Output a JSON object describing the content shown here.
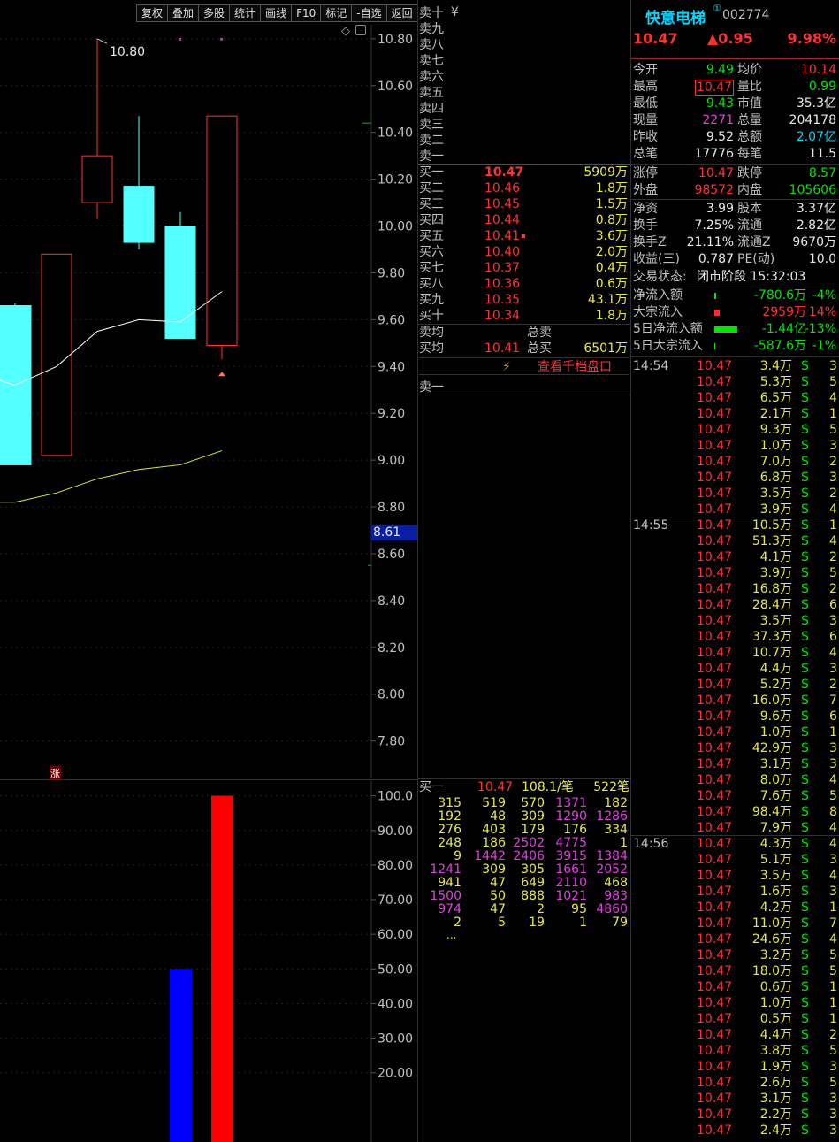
{
  "toolbar": {
    "buttons": [
      "复权",
      "叠加",
      "多股",
      "统计",
      "画线",
      "F10",
      "标记",
      "-自选",
      "返回"
    ]
  },
  "chart": {
    "price_axis": [
      "10.80",
      "10.60",
      "10.40",
      "10.20",
      "10.00",
      "9.80",
      "9.60",
      "9.40",
      "9.20",
      "9.00",
      "8.80",
      "8.60",
      "8.40",
      "8.20",
      "8.00",
      "7.80"
    ],
    "cursor_price": "8.61",
    "high_label": "10.80",
    "zhang_marker": "涨",
    "vol_axis": [
      "100.0",
      "90.00",
      "80.00",
      "70.00",
      "60.00",
      "50.00",
      "40.00",
      "30.00",
      "20.00"
    ],
    "colors": {
      "up": "#ff3232",
      "down": "#54ffff",
      "ma5": "#ffffff",
      "ma10": "#e8e84a",
      "vol_up": "#ff0000",
      "vol_down": "#0000ff"
    }
  },
  "orderbook": {
    "sell": [
      {
        "label": "卖十",
        "price": "",
        "vol": ""
      },
      {
        "label": "卖九",
        "price": "",
        "vol": ""
      },
      {
        "label": "卖八",
        "price": "",
        "vol": ""
      },
      {
        "label": "卖七",
        "price": "",
        "vol": ""
      },
      {
        "label": "卖六",
        "price": "",
        "vol": ""
      },
      {
        "label": "卖五",
        "price": "",
        "vol": ""
      },
      {
        "label": "卖四",
        "price": "",
        "vol": ""
      },
      {
        "label": "卖三",
        "price": "",
        "vol": ""
      },
      {
        "label": "卖二",
        "price": "",
        "vol": ""
      },
      {
        "label": "卖一",
        "price": "",
        "vol": ""
      }
    ],
    "yen_icon": "¥",
    "buy": [
      {
        "label": "买一",
        "price": "10.47",
        "vol": "5909万"
      },
      {
        "label": "买二",
        "price": "10.46",
        "vol": "1.8万"
      },
      {
        "label": "买三",
        "price": "10.45",
        "vol": "1.5万"
      },
      {
        "label": "买四",
        "price": "10.44",
        "vol": "0.8万"
      },
      {
        "label": "买五",
        "price": "10.41",
        "vol": "3.6万"
      },
      {
        "label": "买六",
        "price": "10.40",
        "vol": "2.0万"
      },
      {
        "label": "买七",
        "price": "10.37",
        "vol": "0.4万"
      },
      {
        "label": "买八",
        "price": "10.36",
        "vol": "0.6万"
      },
      {
        "label": "买九",
        "price": "10.35",
        "vol": "43.1万"
      },
      {
        "label": "买十",
        "price": "10.34",
        "vol": "1.8万"
      }
    ],
    "avg_sell_label": "卖均",
    "total_sell_label": "总卖",
    "avg_buy_label": "买均",
    "avg_buy_price": "10.41",
    "total_buy_label": "总买",
    "total_buy_vol": "6501万",
    "view_1000_label": "查看千档盘口",
    "sell1_label": "卖一"
  },
  "queue": {
    "label": "买一",
    "price": "10.47",
    "avg": "108.1/笔",
    "count": "522笔",
    "rows": [
      [
        {
          "v": "315",
          "c": "y"
        },
        {
          "v": "519",
          "c": "y"
        },
        {
          "v": "570",
          "c": "y"
        },
        {
          "v": "1371",
          "c": "m"
        },
        {
          "v": "182",
          "c": "y"
        }
      ],
      [
        {
          "v": "192",
          "c": "y"
        },
        {
          "v": "48",
          "c": "y"
        },
        {
          "v": "309",
          "c": "y"
        },
        {
          "v": "1290",
          "c": "m"
        },
        {
          "v": "1286",
          "c": "m"
        }
      ],
      [
        {
          "v": "276",
          "c": "y"
        },
        {
          "v": "403",
          "c": "y"
        },
        {
          "v": "179",
          "c": "y"
        },
        {
          "v": "176",
          "c": "y"
        },
        {
          "v": "334",
          "c": "y"
        }
      ],
      [
        {
          "v": "248",
          "c": "y"
        },
        {
          "v": "186",
          "c": "y"
        },
        {
          "v": "2502",
          "c": "m"
        },
        {
          "v": "4775",
          "c": "m"
        },
        {
          "v": "1",
          "c": "y"
        }
      ],
      [
        {
          "v": "9",
          "c": "y"
        },
        {
          "v": "1442",
          "c": "m"
        },
        {
          "v": "2406",
          "c": "m"
        },
        {
          "v": "3915",
          "c": "m"
        },
        {
          "v": "1384",
          "c": "m"
        }
      ],
      [
        {
          "v": "1241",
          "c": "m"
        },
        {
          "v": "309",
          "c": "y"
        },
        {
          "v": "305",
          "c": "y"
        },
        {
          "v": "1661",
          "c": "m"
        },
        {
          "v": "2052",
          "c": "m"
        }
      ],
      [
        {
          "v": "941",
          "c": "y"
        },
        {
          "v": "47",
          "c": "y"
        },
        {
          "v": "649",
          "c": "y"
        },
        {
          "v": "2110",
          "c": "m"
        },
        {
          "v": "468",
          "c": "y"
        }
      ],
      [
        {
          "v": "1500",
          "c": "m"
        },
        {
          "v": "50",
          "c": "y"
        },
        {
          "v": "888",
          "c": "y"
        },
        {
          "v": "1021",
          "c": "m"
        },
        {
          "v": "983",
          "c": "m"
        }
      ],
      [
        {
          "v": "974",
          "c": "m"
        },
        {
          "v": "47",
          "c": "y"
        },
        {
          "v": "2",
          "c": "y"
        },
        {
          "v": "95",
          "c": "y"
        },
        {
          "v": "4860",
          "c": "m"
        }
      ],
      [
        {
          "v": "2",
          "c": "y"
        },
        {
          "v": "5",
          "c": "y"
        },
        {
          "v": "19",
          "c": "y"
        },
        {
          "v": "1",
          "c": "y"
        },
        {
          "v": "79",
          "c": "y"
        }
      ]
    ],
    "more": "..."
  },
  "stock": {
    "name": "快意电梯",
    "superscript": "①",
    "code": "002774",
    "price": "10.47",
    "change": "▲0.95",
    "pct": "9.98%"
  },
  "quote": [
    {
      "l1": "今开",
      "v1": "9.49",
      "c1": "green",
      "l2": "均价",
      "v2": "10.14",
      "c2": "red"
    },
    {
      "l1": "最高",
      "v1": "10.47",
      "c1": "red",
      "l2": "量比",
      "v2": "0.99",
      "c2": "green",
      "box": true
    },
    {
      "l1": "最低",
      "v1": "9.43",
      "c1": "green",
      "l2": "市值",
      "v2": "35.3亿",
      "c2": "white"
    },
    {
      "l1": "现量",
      "v1": "2271",
      "c1": "magenta",
      "l2": "总量",
      "v2": "204178",
      "c2": "white"
    },
    {
      "l1": "昨收",
      "v1": "9.52",
      "c1": "white",
      "l2": "总额",
      "v2": "2.07亿",
      "c2": "cyan"
    },
    {
      "l1": "总笔",
      "v1": "17776",
      "c1": "white",
      "l2": "每笔",
      "v2": "11.5",
      "c2": "white"
    }
  ],
  "quote2": [
    {
      "l1": "涨停",
      "v1": "10.47",
      "c1": "red",
      "l2": "跌停",
      "v2": "8.57",
      "c2": "green"
    },
    {
      "l1": "外盘",
      "v1": "98572",
      "c1": "red",
      "l2": "内盘",
      "v2": "105606",
      "c2": "green"
    }
  ],
  "quote3": [
    {
      "l1": "净资",
      "v1": "3.99",
      "c1": "white",
      "l2": "股本",
      "v2": "3.37亿",
      "c2": "white"
    },
    {
      "l1": "换手",
      "v1": "7.25%",
      "c1": "white",
      "l2": "流通",
      "v2": "2.82亿",
      "c2": "white"
    },
    {
      "l1": "换手Z",
      "v1": "21.11%",
      "c1": "white",
      "l2": "流通Z",
      "v2": "9670万",
      "c2": "white"
    },
    {
      "l1": "收益(三)",
      "v1": "0.787",
      "c1": "white",
      "l2": "PE(动)",
      "v2": "10.0",
      "c2": "white"
    }
  ],
  "trade_status": {
    "label": "交易状态:",
    "value": "闭市阶段 15:32:03"
  },
  "flows": [
    {
      "label": "净流入额",
      "value": "-780.6万",
      "pct": "-4%",
      "color": "green",
      "bar": 2,
      "barcolor": "#00e600"
    },
    {
      "label": "大宗流入",
      "value": "2959万",
      "pct": "14%",
      "color": "red",
      "bar": 6,
      "barcolor": "#ff3232"
    },
    {
      "label": "5日净流入额",
      "value": "-1.44亿",
      "pct": "-13%",
      "color": "green",
      "bar": 26,
      "barcolor": "#00e600"
    },
    {
      "label": "5日大宗流入",
      "value": "-587.6万",
      "pct": "-1%",
      "color": "green",
      "bar": 1,
      "barcolor": "#00e600"
    }
  ],
  "ticks": [
    {
      "t": "14:54",
      "p": "10.47",
      "v": "3.4万",
      "s": "S",
      "n": "3"
    },
    {
      "t": "",
      "p": "10.47",
      "v": "5.3万",
      "s": "S",
      "n": "5"
    },
    {
      "t": "",
      "p": "10.47",
      "v": "6.5万",
      "s": "S",
      "n": "4"
    },
    {
      "t": "",
      "p": "10.47",
      "v": "2.1万",
      "s": "S",
      "n": "1"
    },
    {
      "t": "",
      "p": "10.47",
      "v": "9.3万",
      "s": "S",
      "n": "5"
    },
    {
      "t": "",
      "p": "10.47",
      "v": "1.0万",
      "s": "S",
      "n": "3"
    },
    {
      "t": "",
      "p": "10.47",
      "v": "7.0万",
      "s": "S",
      "n": "2"
    },
    {
      "t": "",
      "p": "10.47",
      "v": "6.8万",
      "s": "S",
      "n": "3"
    },
    {
      "t": "",
      "p": "10.47",
      "v": "3.5万",
      "s": "S",
      "n": "2"
    },
    {
      "t": "",
      "p": "10.47",
      "v": "3.9万",
      "s": "S",
      "n": "4"
    },
    {
      "t": "14:55",
      "p": "10.47",
      "v": "10.5万",
      "s": "S",
      "n": "1"
    },
    {
      "t": "",
      "p": "10.47",
      "v": "51.3万",
      "s": "S",
      "n": "4"
    },
    {
      "t": "",
      "p": "10.47",
      "v": "4.1万",
      "s": "S",
      "n": "2"
    },
    {
      "t": "",
      "p": "10.47",
      "v": "3.9万",
      "s": "S",
      "n": "5"
    },
    {
      "t": "",
      "p": "10.47",
      "v": "16.8万",
      "s": "S",
      "n": "2"
    },
    {
      "t": "",
      "p": "10.47",
      "v": "28.4万",
      "s": "S",
      "n": "6"
    },
    {
      "t": "",
      "p": "10.47",
      "v": "3.5万",
      "s": "S",
      "n": "3"
    },
    {
      "t": "",
      "p": "10.47",
      "v": "37.3万",
      "s": "S",
      "n": "6"
    },
    {
      "t": "",
      "p": "10.47",
      "v": "10.7万",
      "s": "S",
      "n": "4"
    },
    {
      "t": "",
      "p": "10.47",
      "v": "4.4万",
      "s": "S",
      "n": "3"
    },
    {
      "t": "",
      "p": "10.47",
      "v": "5.2万",
      "s": "S",
      "n": "2"
    },
    {
      "t": "",
      "p": "10.47",
      "v": "16.0万",
      "s": "S",
      "n": "7"
    },
    {
      "t": "",
      "p": "10.47",
      "v": "9.6万",
      "s": "S",
      "n": "6"
    },
    {
      "t": "",
      "p": "10.47",
      "v": "1.0万",
      "s": "S",
      "n": "1"
    },
    {
      "t": "",
      "p": "10.47",
      "v": "42.9万",
      "s": "S",
      "n": "3"
    },
    {
      "t": "",
      "p": "10.47",
      "v": "3.1万",
      "s": "S",
      "n": "3"
    },
    {
      "t": "",
      "p": "10.47",
      "v": "8.0万",
      "s": "S",
      "n": "4"
    },
    {
      "t": "",
      "p": "10.47",
      "v": "7.6万",
      "s": "S",
      "n": "5"
    },
    {
      "t": "",
      "p": "10.47",
      "v": "98.4万",
      "s": "S",
      "n": "8"
    },
    {
      "t": "",
      "p": "10.47",
      "v": "7.9万",
      "s": "S",
      "n": "4"
    },
    {
      "t": "14:56",
      "p": "10.47",
      "v": "4.3万",
      "s": "S",
      "n": "4"
    },
    {
      "t": "",
      "p": "10.47",
      "v": "5.1万",
      "s": "S",
      "n": "3"
    },
    {
      "t": "",
      "p": "10.47",
      "v": "3.5万",
      "s": "S",
      "n": "4"
    },
    {
      "t": "",
      "p": "10.47",
      "v": "1.6万",
      "s": "S",
      "n": "3"
    },
    {
      "t": "",
      "p": "10.47",
      "v": "4.2万",
      "s": "S",
      "n": "1"
    },
    {
      "t": "",
      "p": "10.47",
      "v": "11.0万",
      "s": "S",
      "n": "7"
    },
    {
      "t": "",
      "p": "10.47",
      "v": "24.6万",
      "s": "S",
      "n": "4"
    },
    {
      "t": "",
      "p": "10.47",
      "v": "3.2万",
      "s": "S",
      "n": "5"
    },
    {
      "t": "",
      "p": "10.47",
      "v": "18.0万",
      "s": "S",
      "n": "5"
    },
    {
      "t": "",
      "p": "10.47",
      "v": "0.6万",
      "s": "S",
      "n": "1"
    },
    {
      "t": "",
      "p": "10.47",
      "v": "1.0万",
      "s": "S",
      "n": "1"
    },
    {
      "t": "",
      "p": "10.47",
      "v": "0.5万",
      "s": "S",
      "n": "1"
    },
    {
      "t": "",
      "p": "10.47",
      "v": "4.4万",
      "s": "S",
      "n": "2"
    },
    {
      "t": "",
      "p": "10.47",
      "v": "3.8万",
      "s": "S",
      "n": "5"
    },
    {
      "t": "",
      "p": "10.47",
      "v": "1.9万",
      "s": "S",
      "n": "3"
    },
    {
      "t": "",
      "p": "10.47",
      "v": "2.6万",
      "s": "S",
      "n": "5"
    },
    {
      "t": "",
      "p": "10.47",
      "v": "3.1万",
      "s": "S",
      "n": "3"
    },
    {
      "t": "",
      "p": "10.47",
      "v": "2.2万",
      "s": "S",
      "n": "3"
    },
    {
      "t": "",
      "p": "10.47",
      "v": "2.4万",
      "s": "S",
      "n": "3"
    }
  ]
}
